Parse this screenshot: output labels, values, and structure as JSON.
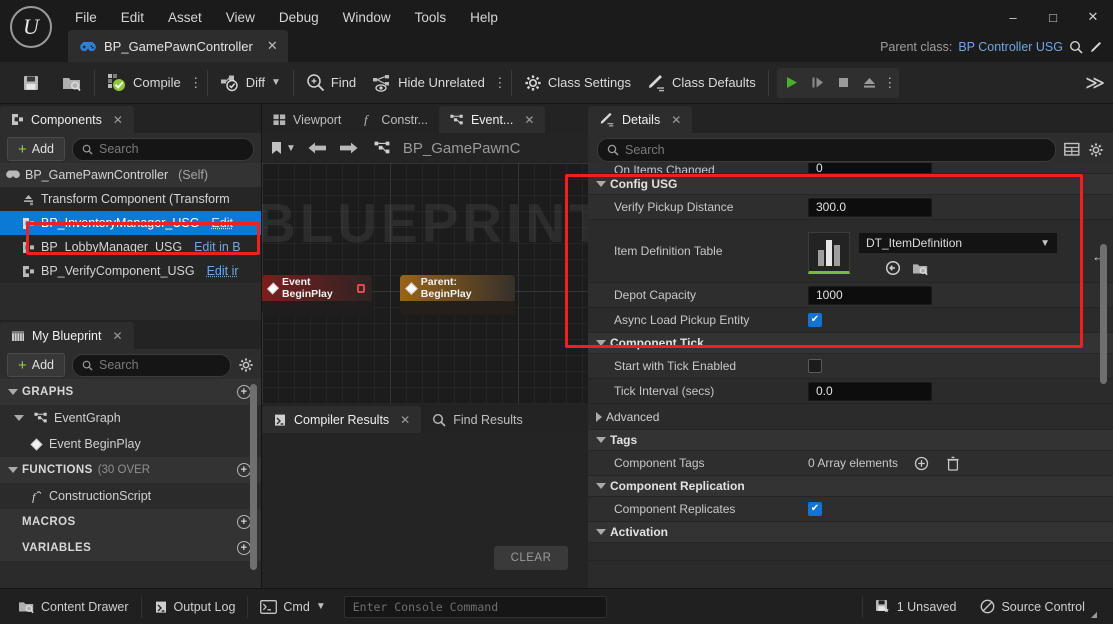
{
  "window": {
    "menus": [
      "File",
      "Edit",
      "Asset",
      "View",
      "Debug",
      "Window",
      "Tools",
      "Help"
    ],
    "asset_tab": "BP_GamePawnController",
    "asset_tab_icon": "gamepad-icon",
    "minimize": "–",
    "maximize": "□",
    "close": "✕",
    "parent_class_label": "Parent class:",
    "parent_class_value": "BP Controller USG"
  },
  "toolbar": {
    "save_icon": "save-icon",
    "browse_icon": "browse-content-icon",
    "compile_label": "Compile",
    "diff_label": "Diff",
    "find_label": "Find",
    "hide_unrelated_label": "Hide Unrelated",
    "class_settings_label": "Class Settings",
    "class_defaults_label": "Class Defaults",
    "play_icon": "play-icon",
    "step_icon": "step-icon",
    "stop_icon": "stop-icon",
    "eject_icon": "eject-icon",
    "overflow_icon": "chevron-double-right-icon"
  },
  "components": {
    "tab_label": "Components",
    "add_label": "Add",
    "search_placeholder": "Search",
    "items": [
      {
        "label": "BP_GamePawnController",
        "suffix": "(Self)",
        "edit": "",
        "state": "self",
        "indent": 0
      },
      {
        "label": "Transform Component (Transform",
        "suffix": "",
        "edit": "",
        "state": "",
        "indent": 1
      },
      {
        "label": "BP_InventoryManager_USG",
        "suffix": "",
        "edit": "Edit",
        "state": "selected",
        "indent": 1
      },
      {
        "label": "BP_LobbyManager_USG",
        "suffix": "",
        "edit": "Edit in B",
        "state": "",
        "indent": 1
      },
      {
        "label": "BP_VerifyComponent_USG",
        "suffix": "",
        "edit": "Edit ir",
        "state": "",
        "indent": 1
      }
    ]
  },
  "my_blueprint": {
    "tab_label": "My Blueprint",
    "add_label": "Add",
    "search_placeholder": "Search",
    "settings_icon": "gear-icon",
    "sections": [
      {
        "type": "category",
        "label": "GRAPHS",
        "count": "",
        "expanded": true
      },
      {
        "type": "node",
        "label": "EventGraph",
        "icon": "graph-icon",
        "expanded": true
      },
      {
        "type": "leaf",
        "label": "Event BeginPlay",
        "icon": "event-icon"
      },
      {
        "type": "category",
        "label": "FUNCTIONS",
        "count": "(30 OVER",
        "expanded": true
      },
      {
        "type": "leaf",
        "label": "ConstructionScript",
        "icon": "function-icon"
      },
      {
        "type": "category",
        "label": "MACROS",
        "count": "",
        "expanded": false
      },
      {
        "type": "category",
        "label": "VARIABLES",
        "count": "",
        "expanded": false
      }
    ]
  },
  "graph": {
    "tabs": [
      {
        "label": "Viewport",
        "icon": "viewport-icon",
        "active": false,
        "closable": false
      },
      {
        "label": "Constr...",
        "icon": "function-icon",
        "active": false,
        "closable": false
      },
      {
        "label": "Event...",
        "icon": "graph-icon",
        "active": true,
        "closable": true
      }
    ],
    "toolbar": {
      "bookmark_icon": "bookmark-icon",
      "back_icon": "arrow-left-icon",
      "forward_icon": "arrow-right-icon",
      "graph_icon": "graph-icon",
      "breadcrumb": "BP_GamePawnC"
    },
    "watermark": "BLUEPRINT",
    "nodes": [
      {
        "title": "Event BeginPlay",
        "color": "red",
        "has_badge": true
      },
      {
        "title": "Parent: BeginPlay",
        "color": "orange",
        "has_badge": false
      }
    ]
  },
  "results": {
    "tabs": [
      {
        "label": "Compiler Results",
        "icon": "compiler-icon",
        "active": true,
        "closable": true
      },
      {
        "label": "Find Results",
        "icon": "search-icon",
        "active": false,
        "closable": false
      }
    ],
    "clear_label": "CLEAR"
  },
  "details": {
    "tab_label": "Details",
    "search_placeholder": "Search",
    "column_icon": "columns-icon",
    "settings_icon": "gear-icon",
    "partial_top_row": {
      "label": "On Items Changed",
      "value": "0"
    },
    "sections": [
      {
        "id": "config-usg",
        "title": "Config USG",
        "expanded": true,
        "highlighted": true,
        "rows": [
          {
            "type": "number",
            "label": "Verify Pickup Distance",
            "value": "300.0"
          },
          {
            "type": "asset",
            "label": "Item Definition Table",
            "value": "DT_ItemDefinition",
            "thumbnail_icon": "datatable-icon",
            "browse_icon": "browse-content-icon",
            "use_selected_icon": "use-selected-icon",
            "reset_icon": "reset-arrow-icon"
          },
          {
            "type": "number",
            "label": "Depot Capacity",
            "value": "1000"
          },
          {
            "type": "checkbox",
            "label": "Async Load Pickup Entity",
            "checked": true
          }
        ]
      },
      {
        "id": "component-tick",
        "title": "Component Tick",
        "expanded": true,
        "highlighted": false,
        "rows": [
          {
            "type": "checkbox",
            "label": "Start with Tick Enabled",
            "checked": false
          },
          {
            "type": "number",
            "label": "Tick Interval (secs)",
            "value": "0.0"
          },
          {
            "type": "subsection",
            "label": "Advanced",
            "expanded": false
          }
        ]
      },
      {
        "id": "tags",
        "title": "Tags",
        "expanded": true,
        "highlighted": false,
        "rows": [
          {
            "type": "array",
            "label": "Component Tags",
            "value": "0 Array elements",
            "add_icon": "plus-circle-icon",
            "delete_icon": "trash-icon"
          }
        ]
      },
      {
        "id": "component-replication",
        "title": "Component Replication",
        "expanded": true,
        "highlighted": false,
        "rows": [
          {
            "type": "checkbox",
            "label": "Component Replicates",
            "checked": true
          }
        ]
      },
      {
        "id": "activation",
        "title": "Activation",
        "expanded": true,
        "highlighted": false,
        "rows": []
      }
    ]
  },
  "statusbar": {
    "content_drawer": "Content Drawer",
    "output_log": "Output Log",
    "cmd_label": "Cmd",
    "console_placeholder": "Enter Console Command",
    "unsaved": "1 Unsaved",
    "source_control": "Source Control"
  },
  "colors": {
    "accent_blue": "#0a7ad4",
    "link_blue": "#6fa8e0",
    "annotation_red": "#ef2020",
    "compile_green": "#9ccc4a",
    "play_green": "#4caf2a",
    "panel_bg": "#2b2b2b",
    "window_bg": "#1b1b1b"
  }
}
